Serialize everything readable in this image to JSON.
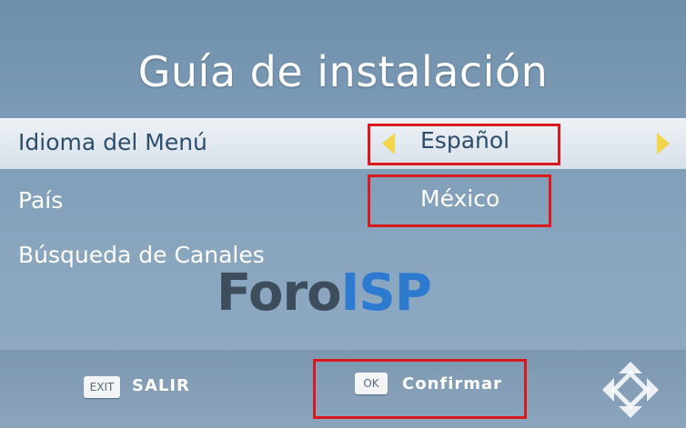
{
  "screen": {
    "title": "Guía de instalación"
  },
  "menu": {
    "items": [
      {
        "label": "Idioma del Menú",
        "value": "Español",
        "selected": true
      },
      {
        "label": "País",
        "value": "México",
        "selected": false
      },
      {
        "label": "Búsqueda de Canales",
        "value": "",
        "selected": false
      }
    ]
  },
  "watermark": {
    "part1": "Foro",
    "part2": "ISP"
  },
  "footer": {
    "exit_key": "EXIT",
    "exit_label": "SALIR",
    "ok_key": "OK",
    "ok_label": "Confirmar"
  },
  "icons": {
    "left_arrow": "left-arrow-icon",
    "right_arrow": "right-arrow-icon",
    "dpad": "dpad-icon"
  },
  "colors": {
    "highlight": "#d9191c",
    "arrow": "#f2d54a",
    "selected_text": "#2e4d6a"
  }
}
